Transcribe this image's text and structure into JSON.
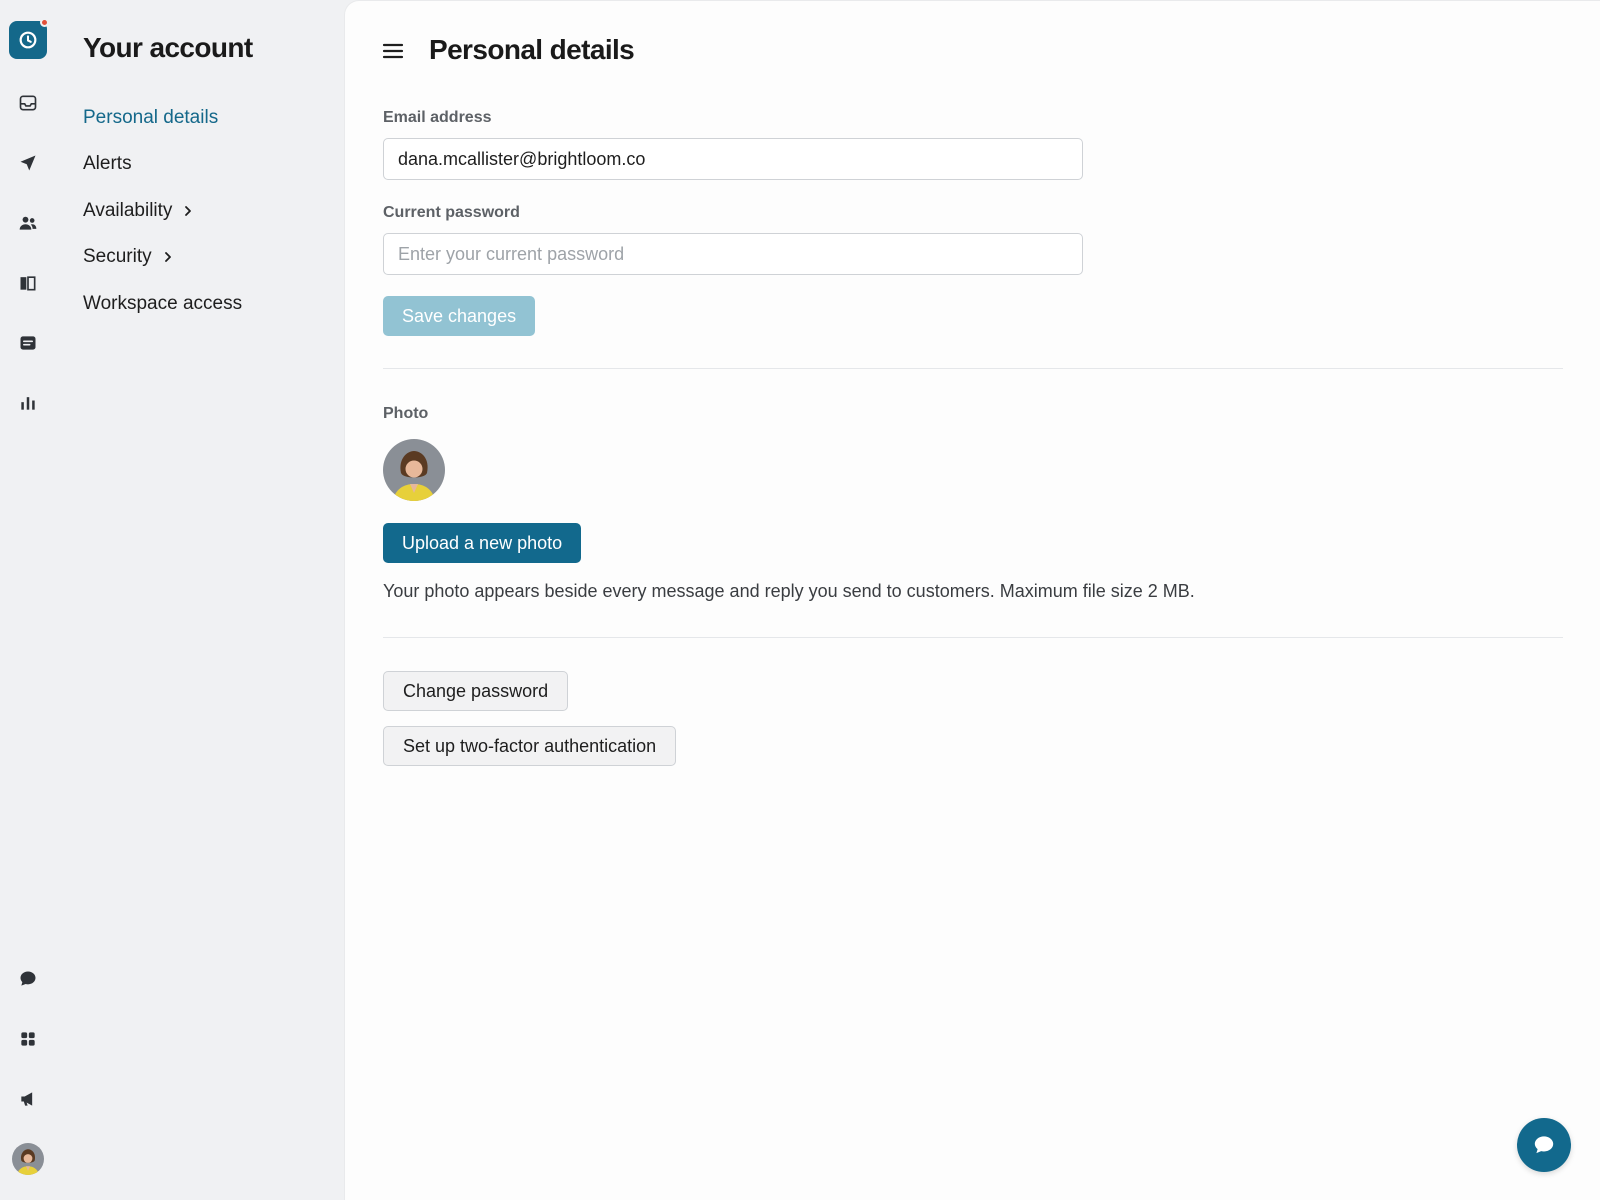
{
  "colors": {
    "accent": "#14688a",
    "primary_button": "#12698d",
    "disabled_button": "#92c3d3",
    "notification_dot": "#e2513a"
  },
  "rail": {
    "items": [
      {
        "icon": "clock-icon"
      },
      {
        "icon": "inbox-icon"
      },
      {
        "icon": "send-icon"
      },
      {
        "icon": "contacts-icon"
      },
      {
        "icon": "book-icon"
      },
      {
        "icon": "message-icon"
      },
      {
        "icon": "bar-chart-icon"
      },
      {
        "icon": "chat-bubble-icon"
      },
      {
        "icon": "apps-grid-icon"
      },
      {
        "icon": "megaphone-icon"
      }
    ]
  },
  "subnav": {
    "title": "Your account",
    "items": [
      {
        "label": "Personal details",
        "active": true
      },
      {
        "label": "Alerts"
      },
      {
        "label": "Availability",
        "expandable": true
      },
      {
        "label": "Security",
        "expandable": true
      },
      {
        "label": "Workspace access"
      }
    ]
  },
  "main": {
    "title": "Personal details",
    "email": {
      "label": "Email address",
      "value": "dana.mcallister@brightloom.co"
    },
    "password": {
      "label": "Current password",
      "placeholder": "Enter your current password"
    },
    "save_label": "Save changes",
    "photo": {
      "label": "Photo",
      "upload_label": "Upload a new photo",
      "helper": "Your photo appears beside every message and reply you send to customers. Maximum file size 2 MB."
    },
    "change_password_label": "Change password",
    "two_factor_label": "Set up two-factor authentication"
  }
}
